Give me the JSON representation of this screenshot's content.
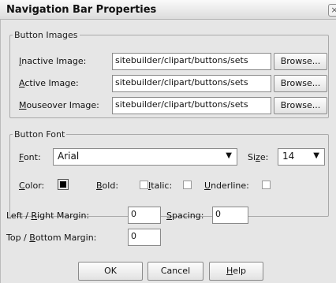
{
  "dialog": {
    "title": "Navigation Bar Properties"
  },
  "button_images": {
    "legend": "Button Images",
    "inactive": {
      "label_key": "I",
      "label_rest": "nactive Image:",
      "value": "sitebuilder/clipart/buttons/sets"
    },
    "active": {
      "label_key": "A",
      "label_rest": "ctive Image:",
      "value": "sitebuilder/clipart/buttons/sets"
    },
    "mouseover": {
      "label_key": "M",
      "label_rest": "ouseover Image:",
      "value": "sitebuilder/clipart/buttons/sets"
    },
    "browse_label": "Browse..."
  },
  "button_font": {
    "legend": "Button Font",
    "font_label_key": "F",
    "font_label_rest": "ont:",
    "font_value": "Arial",
    "size_label_pre": "Si",
    "size_label_key": "z",
    "size_label_post": "e:",
    "size_value": "14",
    "color_label_key": "C",
    "color_label_rest": "olor:",
    "color_value": "#000000",
    "bold_label_key": "B",
    "bold_label_rest": "old:",
    "italic_label_key": "I",
    "italic_label_rest": "talic:",
    "underline_label_key": "U",
    "underline_label_rest": "nderline:"
  },
  "margins": {
    "lr_pre": "Left / ",
    "lr_key": "R",
    "lr_post": "ight Margin:",
    "lr_value": "0",
    "spacing_key": "S",
    "spacing_rest": "pacing:",
    "spacing_value": "0",
    "tb_pre": "Top / ",
    "tb_key": "B",
    "tb_post": "ottom Margin:",
    "tb_value": "0"
  },
  "actions": {
    "ok": "OK",
    "cancel": "Cancel",
    "help_key": "H",
    "help_rest": "elp"
  }
}
